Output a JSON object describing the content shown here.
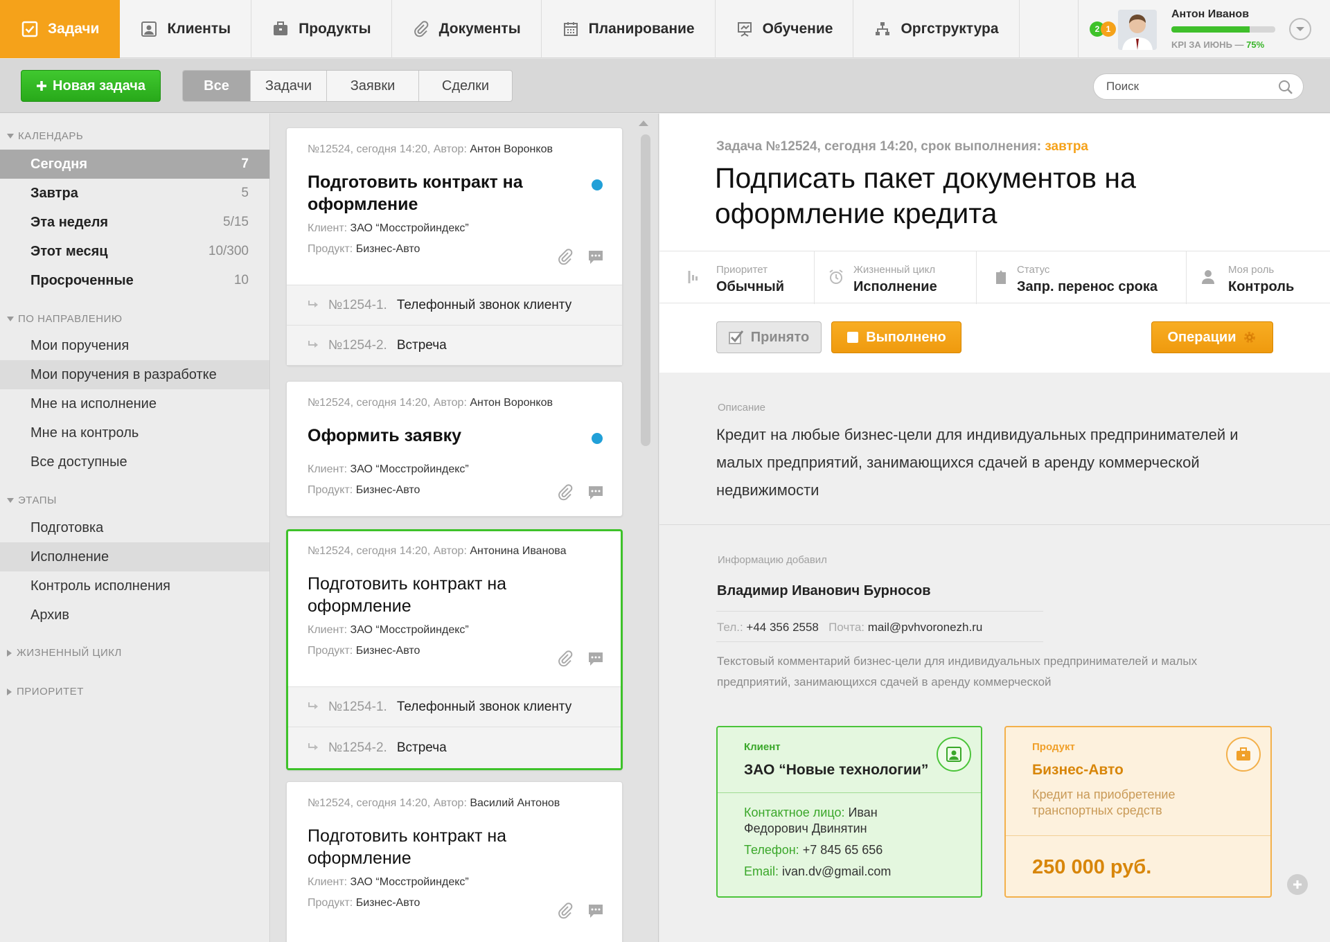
{
  "nav": {
    "tabs": [
      {
        "label": "Задачи",
        "icon": "tasks-icon",
        "active": true
      },
      {
        "label": "Клиенты",
        "icon": "clients-icon"
      },
      {
        "label": "Продукты",
        "icon": "products-icon"
      },
      {
        "label": "Документы",
        "icon": "paperclip-icon"
      },
      {
        "label": "Планирование",
        "icon": "calendar-icon"
      },
      {
        "label": "Обучение",
        "icon": "training-icon"
      },
      {
        "label": "Оргструктура",
        "icon": "orgchart-icon"
      }
    ],
    "user": {
      "name": "Антон Иванов",
      "kpi_label": "KPI ЗА ИЮНЬ — ",
      "kpi_percent": "75%",
      "kpi_value": 0.75,
      "badge_green": "2",
      "badge_orange": "1"
    }
  },
  "toolbar": {
    "new_task": "Новая задача",
    "filters": [
      "Все",
      "Задачи",
      "Заявки",
      "Сделки"
    ],
    "active_filter": "Все",
    "search_placeholder": "Поиск"
  },
  "sidebar": {
    "calendar_title": "КАЛЕНДАРЬ",
    "calendar": [
      {
        "label": "Сегодня",
        "count": "7"
      },
      {
        "label": "Завтра",
        "count": "5"
      },
      {
        "label": "Эта неделя",
        "count": "5/15"
      },
      {
        "label": "Этот месяц",
        "count": "10/300"
      },
      {
        "label": "Просроченные",
        "count": "10"
      }
    ],
    "direction_title": "ПО НАПРАВЛЕНИЮ",
    "direction": [
      "Мои поручения",
      "Мои поручения в разработке",
      "Мне на исполнение",
      "Мне на контроль",
      "Все доступные"
    ],
    "stages_title": "ЭТАПЫ",
    "stages": [
      "Подготовка",
      "Исполнение",
      "Контроль исполнения",
      "Архив"
    ],
    "lifecycle_title": "ЖИЗНЕННЫЙ ЦИКЛ",
    "priority_title": "ПРИОРИТЕТ"
  },
  "tasks": [
    {
      "meta": "№12524, сегодня 14:20, Автор: ",
      "author": "Антон Воронков",
      "title": "Подготовить контракт на оформление",
      "client_label": "Клиент: ",
      "client": "ЗАО “Мосстройиндекс”",
      "product_label": "Продукт: ",
      "product": "Бизнес-Авто",
      "subtasks": [
        {
          "num": "№1254-1.",
          "title": "Телефонный звонок клиенту"
        },
        {
          "num": "№1254-2.",
          "title": "Встреча"
        }
      ]
    },
    {
      "meta": "№12524, сегодня 14:20, Автор: ",
      "author": "Антон Воронков",
      "title": "Оформить заявку",
      "client_label": "Клиент: ",
      "client": "ЗАО “Мосстройиндекс”",
      "product_label": "Продукт: ",
      "product": "Бизнес-Авто"
    },
    {
      "meta": "№12524, сегодня 14:20, Автор: ",
      "author": "Антонина Иванова",
      "title": "Подготовить контракт на оформление",
      "client_label": "Клиент: ",
      "client": "ЗАО “Мосстройиндекс”",
      "product_label": "Продукт: ",
      "product": "Бизнес-Авто",
      "subtasks": [
        {
          "num": "№1254-1.",
          "title": "Телефонный звонок клиенту"
        },
        {
          "num": "№1254-2.",
          "title": "Встреча"
        }
      ]
    },
    {
      "meta": "№12524, сегодня 14:20, Автор: ",
      "author": "Василий Антонов",
      "title": "Подготовить контракт на оформление",
      "client_label": "Клиент: ",
      "client": "ЗАО “Мосстройиндекс”",
      "product_label": "Продукт: ",
      "product": "Бизнес-Авто"
    }
  ],
  "detail": {
    "meta": "Задача №12524, сегодня 14:20, срок выполнения: ",
    "due": "завтра",
    "title": "Подписать пакет документов на оформление кредита",
    "props": [
      {
        "label": "Приоритет",
        "value": "Обычный",
        "icon": "priority-icon"
      },
      {
        "label": "Жизненный цикл",
        "value": "Исполнение",
        "icon": "alarm-clock-icon"
      },
      {
        "label": "Статус",
        "value": "Запр. перенос срока",
        "icon": "status-icon"
      },
      {
        "label": "Моя роль",
        "value": "Контроль",
        "icon": "person-icon"
      }
    ],
    "btn_accepted": "Принято",
    "btn_done": "Выполнено",
    "btn_operations": "Операции",
    "desc_label": "Описание",
    "desc": "Кредит на любые бизнес-цели для индивидуальных предпринимателей и малых предприятий, занимающихся сдачей в аренду коммерческой недвижимости",
    "info_label": "Информацию добавил",
    "info_name": "Владимир Иванович Бурносов",
    "tel_label": "Тел.: ",
    "tel": "+44 356 2558",
    "mail_label": "Почта: ",
    "mail": "mail@pvhvoronezh.ru",
    "comment": "Текстовый комментарий бизнес-цели для индивидуальных предпринимателей и малых предприятий, занимающихся сдачей в аренду коммерческой",
    "client_box": {
      "label": "Клиент",
      "name": "ЗАО “Новые технологии”",
      "contact_label": "Контактное лицо: ",
      "contact": "Иван Федорович Двинятин",
      "phone_label": "Телефон: ",
      "phone": "+7 845 65 656",
      "email_label": "Email: ",
      "email": "ivan.dv@gmail.com"
    },
    "product_box": {
      "label": "Продукт",
      "name": "Бизнес-Авто",
      "desc": "Кредит на приобретение транспортных средств",
      "price": "250 000 руб."
    }
  },
  "colors": {
    "accent": "#f5a21a",
    "green": "#3ec22a",
    "blue_dot": "#21a0d8"
  }
}
